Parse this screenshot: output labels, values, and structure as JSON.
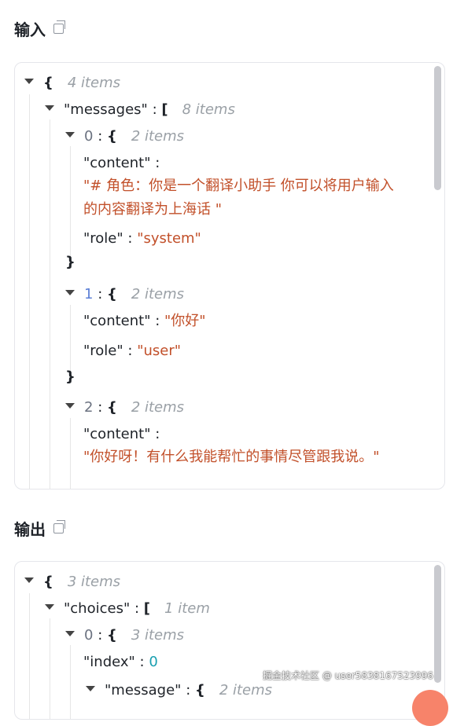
{
  "input_section": {
    "title": "输入",
    "root_count": "4 items",
    "messages_key": "\"messages\"",
    "messages_count": "8 items",
    "msg0": {
      "index": "0",
      "count": "2 items",
      "content_key": "\"content\"",
      "content_value": "\"# 角色：你是一个翻译小助手 你可以将用户输入的内容翻译为上海话 \"",
      "role_key": "\"role\"",
      "role_value": "\"system\""
    },
    "msg1": {
      "index": "1",
      "count": "2 items",
      "content_key": "\"content\"",
      "content_value": "\"你好\"",
      "role_key": "\"role\"",
      "role_value": "\"user\""
    },
    "msg2": {
      "index": "2",
      "count": "2 items",
      "content_key": "\"content\"",
      "content_value": "\"你好呀！有什么我能帮忙的事情尽管跟我说。\""
    }
  },
  "output_section": {
    "title": "输出",
    "root_count": "3 items",
    "choices_key": "\"choices\"",
    "choices_count": "1 item",
    "choice0": {
      "index": "0",
      "count": "3 items",
      "index_key": "\"index\"",
      "index_value": "0",
      "message_key": "\"message\"",
      "message_count": "2 items"
    }
  },
  "symbols": {
    "open_brace": "{",
    "close_brace": "}",
    "open_bracket": "[",
    "colon": ":"
  },
  "watermark": "掘金技术社区 @ user5838167523996",
  "colors": {
    "string": "#c2502a",
    "number": "#1a9fb0",
    "count": "#9aa0a6",
    "scrollbar": "#c9cacf",
    "fab": "#f7836a"
  }
}
